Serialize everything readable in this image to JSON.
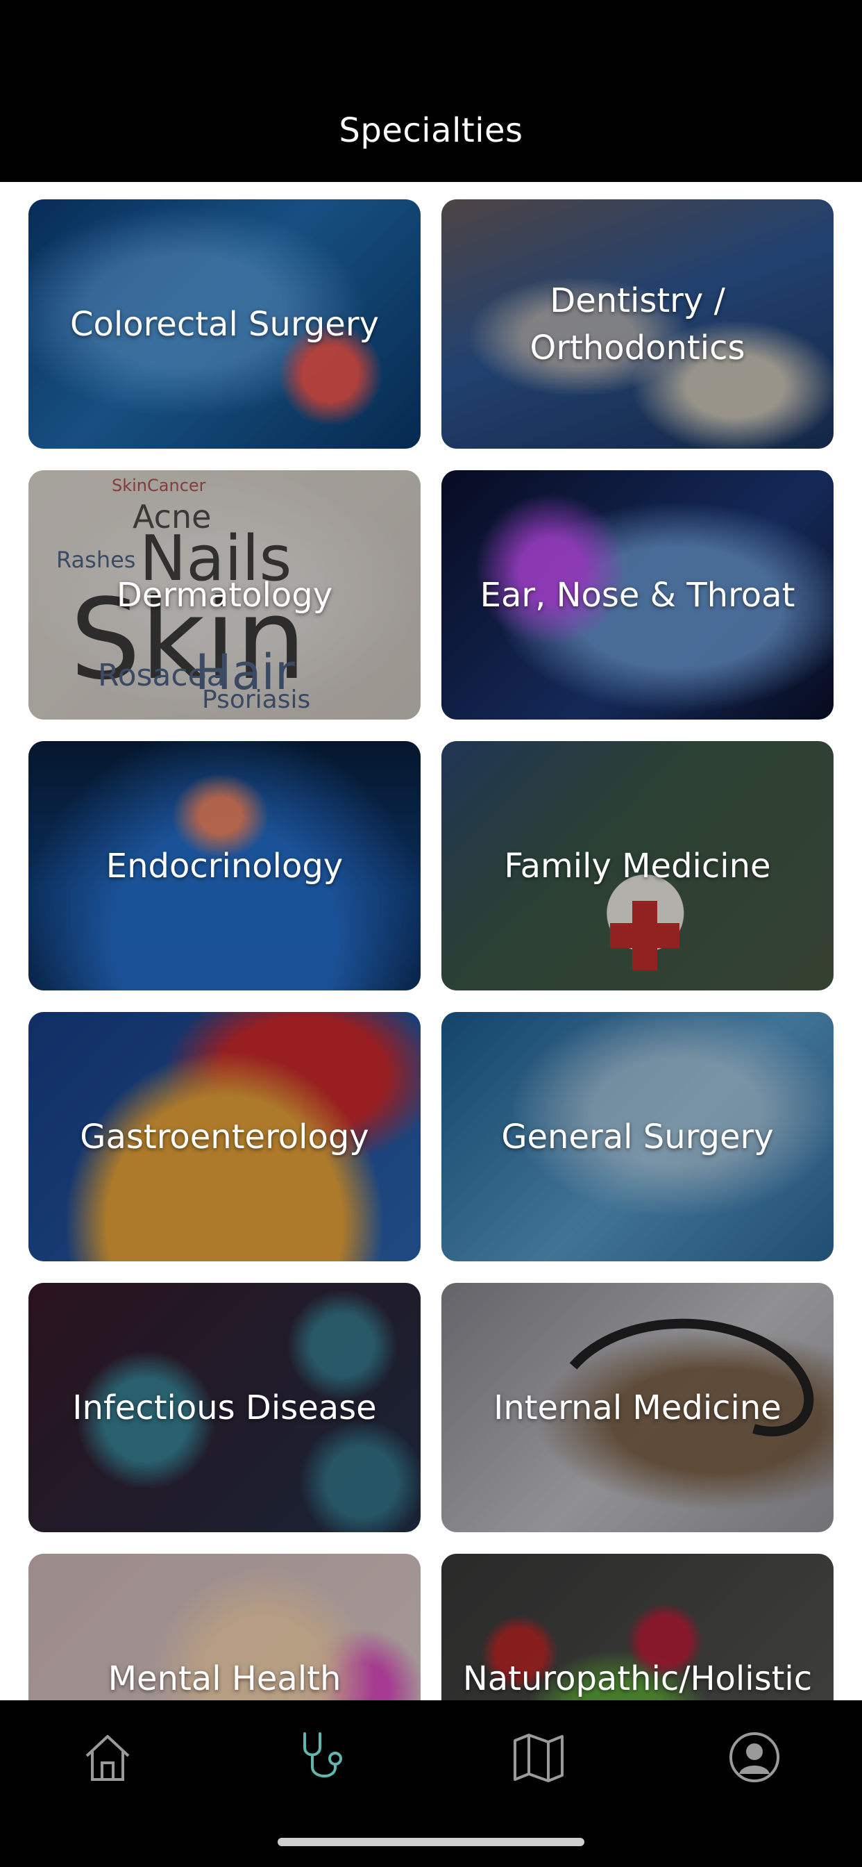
{
  "header": {
    "title": "Specialties"
  },
  "specialties": [
    {
      "label": "Colorectal Surgery",
      "image": "colorectal-image"
    },
    {
      "label": "Dentistry / Orthodontics",
      "image": "dentistry-image"
    },
    {
      "label": "Dermatology",
      "image": "dermatology-wordcloud-image"
    },
    {
      "label": "Ear, Nose & Throat",
      "image": "ent-head-image"
    },
    {
      "label": "Endocrinology",
      "image": "thyroid-image"
    },
    {
      "label": "Family Medicine",
      "image": "first-aid-kit-image"
    },
    {
      "label": "Gastroenterology",
      "image": "stomach-image"
    },
    {
      "label": "General Surgery",
      "image": "surgery-image"
    },
    {
      "label": "Infectious Disease",
      "image": "virus-image"
    },
    {
      "label": "Internal Medicine",
      "image": "stethoscope-image"
    },
    {
      "label": "Mental Health",
      "image": "brain-image"
    },
    {
      "label": "Naturopathic/Holistic",
      "image": "healthy-food-image"
    }
  ],
  "tabbar": {
    "items": [
      {
        "icon": "home-icon",
        "active": false
      },
      {
        "icon": "stethoscope-icon",
        "active": true
      },
      {
        "icon": "map-icon",
        "active": false
      },
      {
        "icon": "profile-icon",
        "active": false
      }
    ],
    "active_color": "#5fb8b0",
    "inactive_color": "#9a9a9a"
  },
  "colors": {
    "header_bg": "#000000",
    "tabbar_bg": "#000000",
    "card_text": "#ffffff"
  }
}
